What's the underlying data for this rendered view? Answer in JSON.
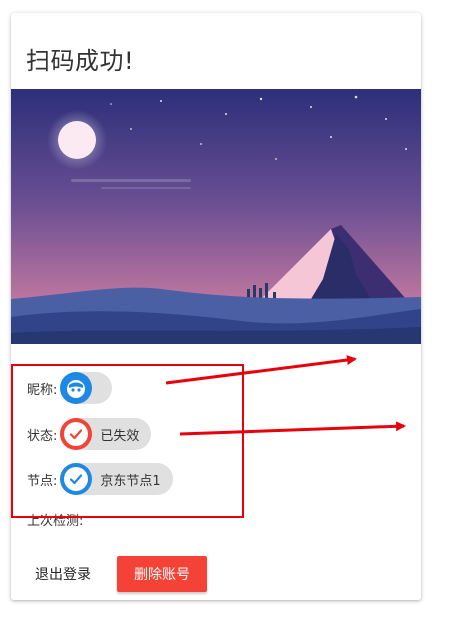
{
  "title": "扫码成功!",
  "fields": {
    "nickname": {
      "label": "昵称:",
      "value": ""
    },
    "status": {
      "label": "状态:",
      "value": "已失效",
      "icon": "check-icon",
      "color": "#f44336"
    },
    "node": {
      "label": "节点:",
      "value": "京东节点1",
      "icon": "check-icon",
      "color": "#1e88e5"
    }
  },
  "last_check_label": "上次检测:",
  "buttons": {
    "logout": "退出登录",
    "delete": "删除账号"
  },
  "colors": {
    "accent_red": "#f44336",
    "accent_blue": "#1e88e5",
    "annotation": "#e8000b"
  }
}
